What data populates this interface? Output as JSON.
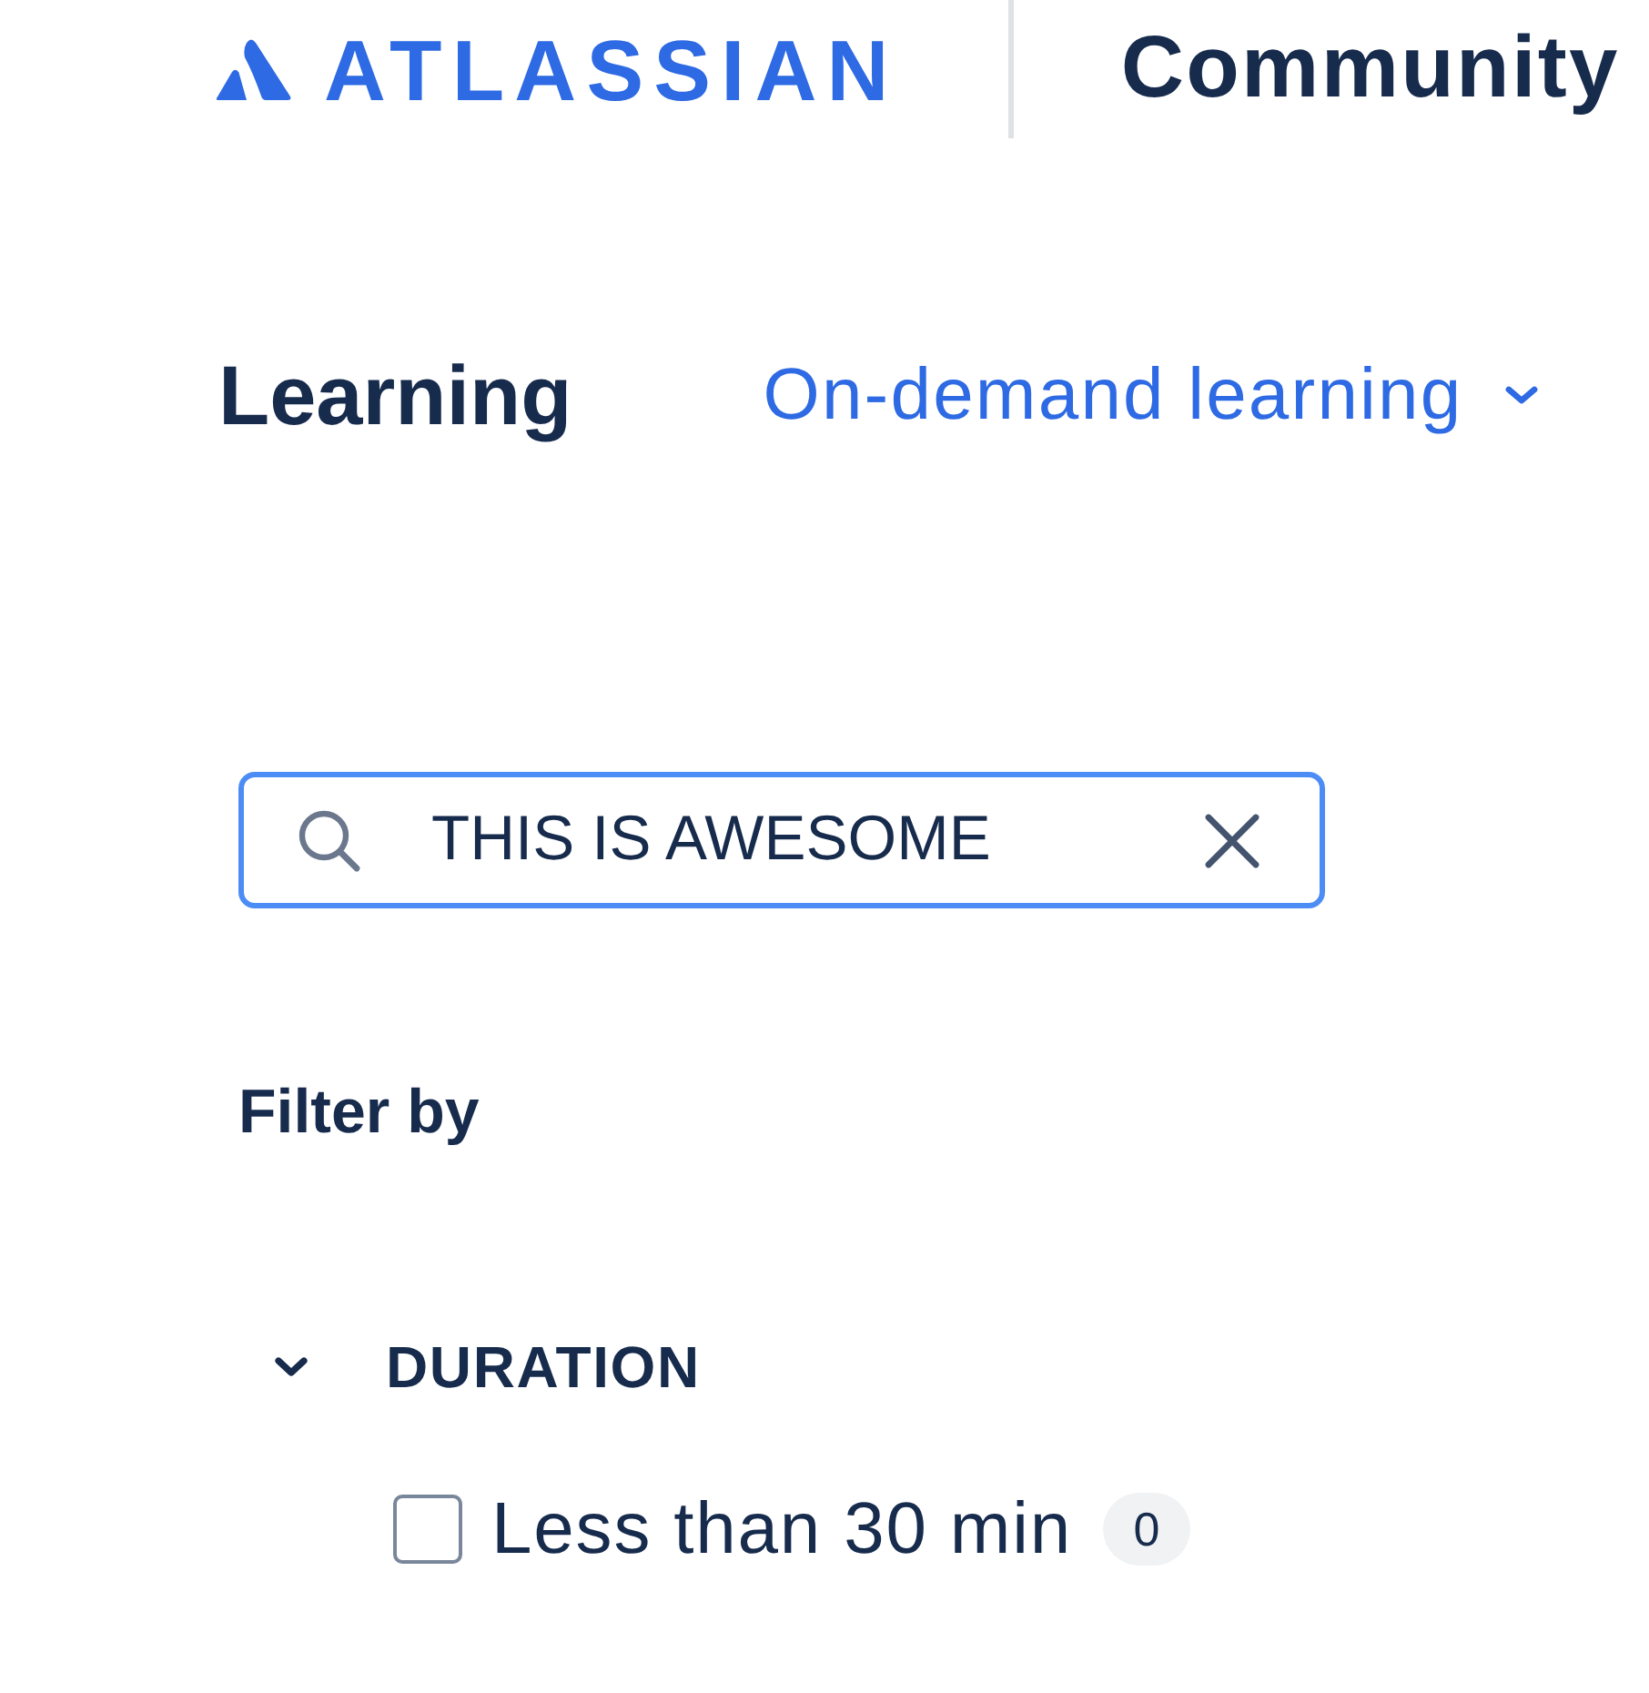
{
  "header": {
    "logo": {
      "wordmark": "ATLASSIAN"
    },
    "site_name": "Community"
  },
  "nav": {
    "title": "Learning",
    "dropdown": {
      "label": "On-demand learning"
    }
  },
  "search": {
    "value": "THIS IS AWESOME"
  },
  "filters": {
    "title": "Filter by",
    "groups": [
      {
        "label": "DURATION",
        "expanded": true,
        "options": [
          {
            "label": "Less than 30 min",
            "count": "0",
            "checked": false
          }
        ]
      }
    ]
  }
}
